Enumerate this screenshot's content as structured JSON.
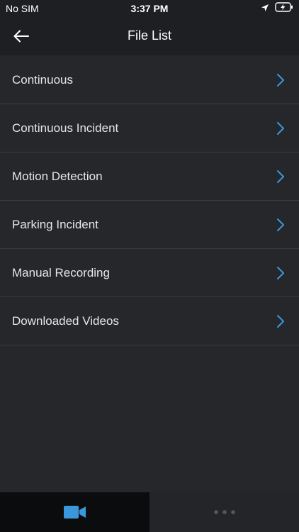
{
  "status": {
    "carrier": "No SIM",
    "time": "3:37 PM",
    "icons": [
      "location-arrow-icon",
      "battery-charging-icon"
    ]
  },
  "nav": {
    "title": "File List",
    "back_icon": "back-arrow-icon"
  },
  "items": [
    {
      "label": "Continuous"
    },
    {
      "label": "Continuous Incident"
    },
    {
      "label": "Motion Detection"
    },
    {
      "label": "Parking Incident"
    },
    {
      "label": "Manual Recording"
    },
    {
      "label": "Downloaded Videos"
    }
  ],
  "tabs": [
    {
      "icon": "video-camera-icon",
      "active": true
    },
    {
      "icon": "more-dots-icon",
      "active": false
    }
  ],
  "colors": {
    "accent": "#3a97db",
    "background": "#25272b",
    "header": "#1d1f22",
    "divider": "#3a3c40"
  }
}
